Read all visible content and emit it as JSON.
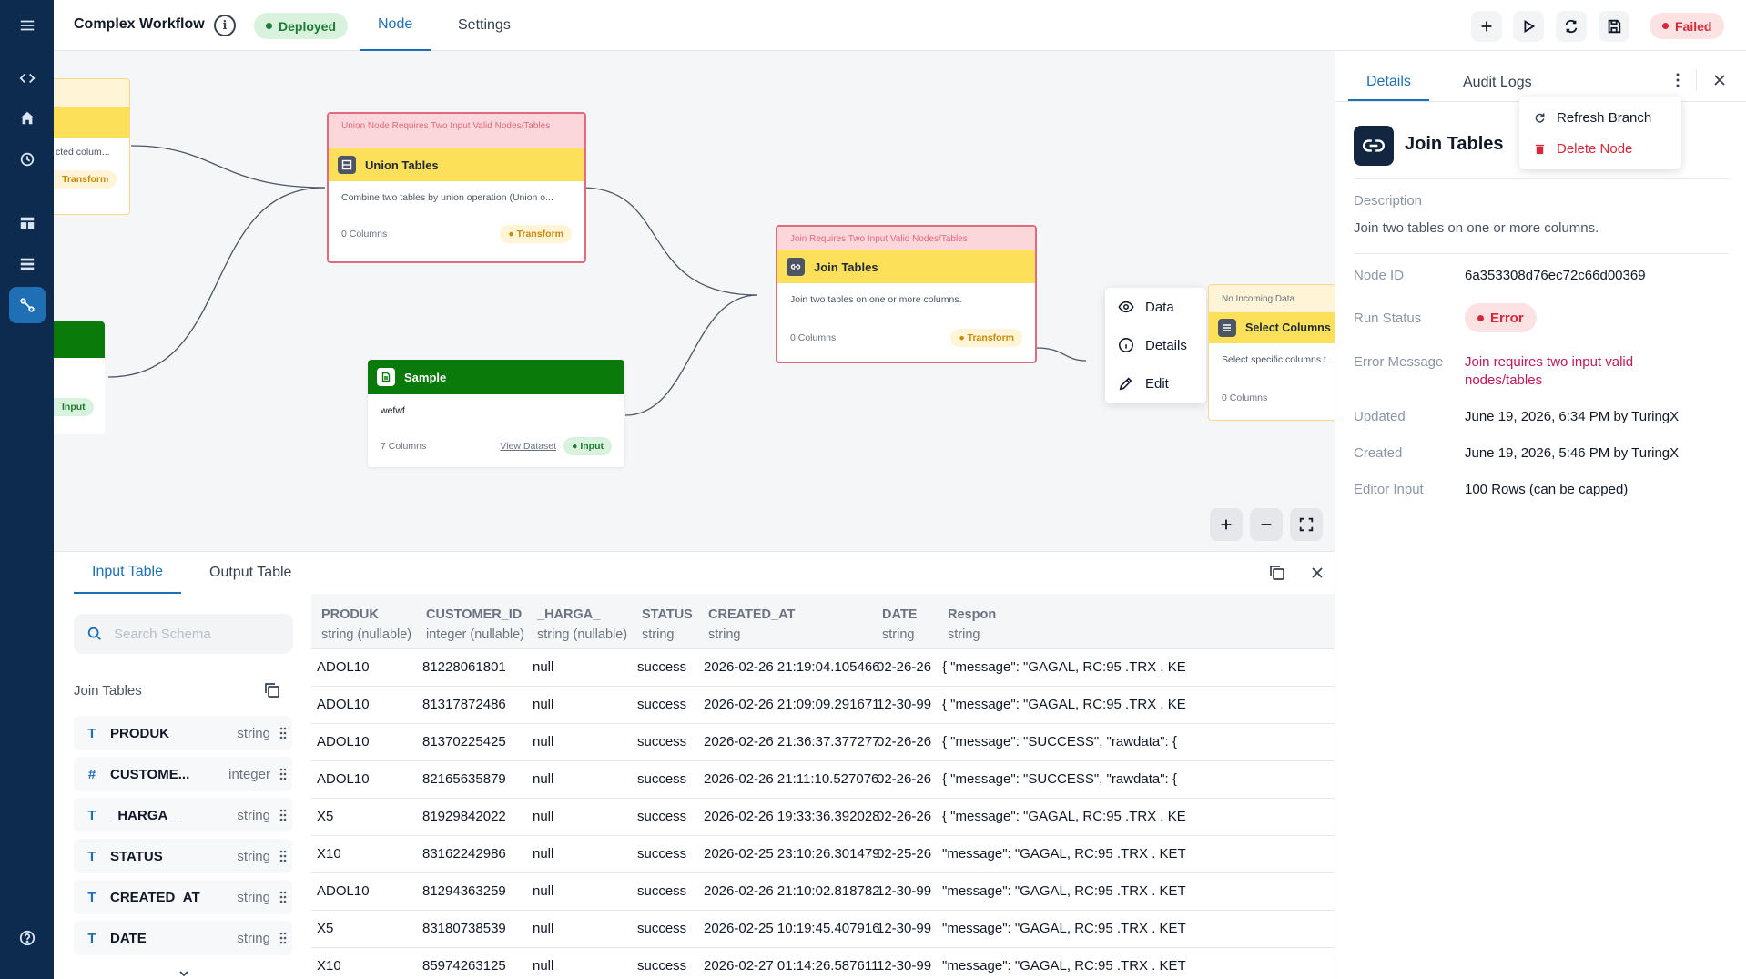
{
  "header": {
    "title": "Complex Workflow",
    "deployed_label": "Deployed",
    "tabs": [
      "Node",
      "Settings"
    ],
    "failed_label": "Failed"
  },
  "colors": {
    "rail": "#0d2b4e",
    "accent": "#1f6fb5",
    "input_green": "#0a7a0a",
    "node_yellow": "#fce05a",
    "error_red": "#d62839"
  },
  "rail_icons": [
    "menu-icon",
    "code-icon",
    "home-icon",
    "history-icon",
    "table-icon",
    "list-icon",
    "workflow-icon",
    "help-icon"
  ],
  "canvas": {
    "nodes": {
      "left_partial_top": {
        "desc": "cted colum...",
        "chip": "Transform"
      },
      "left_partial_green": {
        "chip": "Input"
      },
      "union": {
        "warning": "Union Node Requires Two Input Valid Nodes/Tables",
        "title": "Union Tables",
        "desc": "Combine two tables by union operation (Union o...",
        "columns": "0 Columns",
        "chip": "Transform"
      },
      "sample": {
        "title": "Sample",
        "desc": "wefwf",
        "columns": "7 Columns",
        "link": "View Dataset",
        "chip": "Input"
      },
      "join": {
        "warning": "Join Requires Two Input Valid Nodes/Tables",
        "title": "Join Tables",
        "desc": "Join two tables on one or more columns.",
        "columns": "0 Columns",
        "chip": "Transform"
      },
      "select": {
        "warning": "No Incoming Data",
        "title": "Select Columns",
        "desc": "Select specific columns t",
        "columns": "0 Columns"
      }
    },
    "context_menu": [
      "Data",
      "Details",
      "Edit"
    ]
  },
  "bottom": {
    "tabs": [
      "Input Table",
      "Output Table"
    ],
    "search_placeholder": "Search Schema",
    "schema_title": "Join Tables",
    "schema": [
      {
        "icon": "T",
        "name": "PRODUK",
        "type": "string"
      },
      {
        "icon": "#",
        "name": "CUSTOME...",
        "type": "integer"
      },
      {
        "icon": "T",
        "name": "_HARGA_",
        "type": "string"
      },
      {
        "icon": "T",
        "name": "STATUS",
        "type": "string"
      },
      {
        "icon": "T",
        "name": "CREATED_AT",
        "type": "string"
      },
      {
        "icon": "T",
        "name": "DATE",
        "type": "string"
      }
    ],
    "columns": [
      {
        "name": "PRODUK",
        "type": "string (nullable)"
      },
      {
        "name": "CUSTOMER_ID",
        "type": "integer (nullable)"
      },
      {
        "name": "_HARGA_",
        "type": "string (nullable)"
      },
      {
        "name": "STATUS",
        "type": "string"
      },
      {
        "name": "CREATED_AT",
        "type": "string"
      },
      {
        "name": "DATE",
        "type": "string"
      },
      {
        "name": "Respon",
        "type": "string"
      }
    ],
    "rows": [
      [
        "ADOL10",
        "81228061801",
        "null",
        "success",
        "2026-02-26 21:19:04.105466",
        "02-26-26",
        "{ \"message\": \"GAGAL, RC:95 .TRX . KE"
      ],
      [
        "ADOL10",
        "81317872486",
        "null",
        "success",
        "2026-02-26 21:09:09.291671",
        "12-30-99",
        "{ \"message\": \"GAGAL, RC:95 .TRX . KE"
      ],
      [
        "ADOL10",
        "81370225425",
        "null",
        "success",
        "2026-02-26 21:36:37.377277",
        "02-26-26",
        "{ \"message\": \"SUCCESS\", \"rawdata\": {"
      ],
      [
        "ADOL10",
        "82165635879",
        "null",
        "success",
        "2026-02-26 21:11:10.527076",
        "02-26-26",
        "{ \"message\": \"SUCCESS\", \"rawdata\": {"
      ],
      [
        "X5",
        "81929842022",
        "null",
        "success",
        "2026-02-26 19:33:36.392028",
        "02-26-26",
        "{ \"message\": \"GAGAL, RC:95 .TRX . KE"
      ],
      [
        "X10",
        "83162242986",
        "null",
        "success",
        "2026-02-25 23:10:26.301479",
        "02-25-26",
        "\"message\": \"GAGAL, RC:95 .TRX . KET"
      ],
      [
        "ADOL10",
        "81294363259",
        "null",
        "success",
        "2026-02-26 21:10:02.818782",
        "12-30-99",
        "\"message\": \"GAGAL, RC:95 .TRX . KET"
      ],
      [
        "X5",
        "83180738539",
        "null",
        "success",
        "2026-02-25 10:19:45.407916",
        "12-30-99",
        "\"message\": \"GAGAL, RC:95 .TRX . KET"
      ],
      [
        "X10",
        "85974263125",
        "null",
        "success",
        "2026-02-27 01:14:26.587611",
        "12-30-99",
        "\"message\": \"GAGAL, RC:95 .TRX . KET"
      ]
    ]
  },
  "details": {
    "tabs": [
      "Details",
      "Audit Logs"
    ],
    "menu": [
      "Refresh Branch",
      "Delete Node"
    ],
    "title": "Join Tables",
    "description_label": "Description",
    "description": "Join two tables on one or more columns.",
    "node_id_label": "Node ID",
    "node_id": "6a353308d76ec72c66d00369",
    "run_status_label": "Run Status",
    "run_status": "Error",
    "error_label": "Error Message",
    "error_line1": "Join requires two input valid",
    "error_line2": "nodes/tables",
    "updated_label": "Updated",
    "updated": "June 19, 2026, 6:34 PM by TuringX",
    "created_label": "Created",
    "created": "June 19, 2026, 5:46 PM by TuringX",
    "editor_input_label": "Editor Input",
    "editor_input": "100 Rows (can be capped)"
  }
}
